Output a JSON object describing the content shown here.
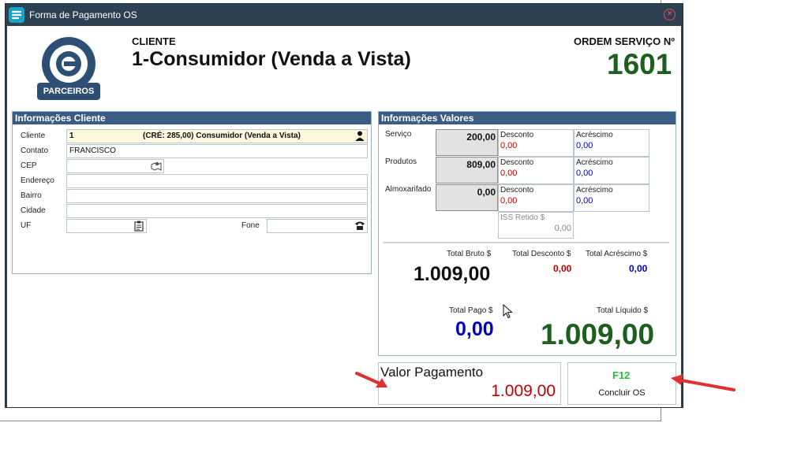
{
  "window": {
    "title": "Forma de Pagamento OS"
  },
  "logo": {
    "text": "PARCEIROS"
  },
  "header": {
    "cliente_label": "CLIENTE",
    "cliente_name": "1-Consumidor (Venda a Vista)",
    "os_label": "ORDEM SERVIÇO Nº",
    "os_number": "1601"
  },
  "info_cliente": {
    "title": "Informações Cliente",
    "fields": {
      "cliente": {
        "label": "Cliente",
        "code": "1",
        "value": "(CRÉ: 285,00) Consumidor (Venda a Vista)"
      },
      "contato": {
        "label": "Contato",
        "value": "FRANCISCO"
      },
      "cep": {
        "label": "CEP",
        "value": ""
      },
      "endereco": {
        "label": "Endereço",
        "value": ""
      },
      "bairro": {
        "label": "Bairro",
        "value": ""
      },
      "cidade": {
        "label": "Cidade",
        "value": ""
      },
      "uf": {
        "label": "UF",
        "value": ""
      },
      "fone": {
        "label": "Fone",
        "value": ""
      }
    }
  },
  "info_valores": {
    "title": "Informações Valores",
    "rows": [
      {
        "label": "Serviço",
        "value": "200,00",
        "desconto_label": "Desconto",
        "desconto": "0,00",
        "acrescimo_label": "Acréscimo",
        "acrescimo": "0,00"
      },
      {
        "label": "Produtos",
        "value": "809,00",
        "desconto_label": "Desconto",
        "desconto": "0,00",
        "acrescimo_label": "Acréscimo",
        "acrescimo": "0,00"
      },
      {
        "label": "Almoxarifado",
        "value": "0,00",
        "desconto_label": "Desconto",
        "desconto": "0,00",
        "acrescimo_label": "Acréscimo",
        "acrescimo": "0,00"
      }
    ],
    "iss": {
      "label": "ISS Retido $",
      "value": "0,00"
    },
    "totals": {
      "bruto_label": "Total Bruto $",
      "bruto": "1.009,00",
      "desconto_label": "Total Desconto $",
      "desconto": "0,00",
      "acrescimo_label": "Total Acréscimo $",
      "acrescimo": "0,00",
      "pago_label": "Total Pago $",
      "pago": "0,00",
      "liquido_label": "Total Líquido $",
      "liquido": "1.009,00"
    }
  },
  "pagamento": {
    "label": "Valor Pagamento",
    "value": "1.009,00"
  },
  "concluir": {
    "shortcut": "F12",
    "label": "Concluir OS"
  },
  "colors": {
    "accent": "#3b5d84",
    "green": "#1e5e1e",
    "red": "#c00000",
    "blue": "#0000bb"
  }
}
